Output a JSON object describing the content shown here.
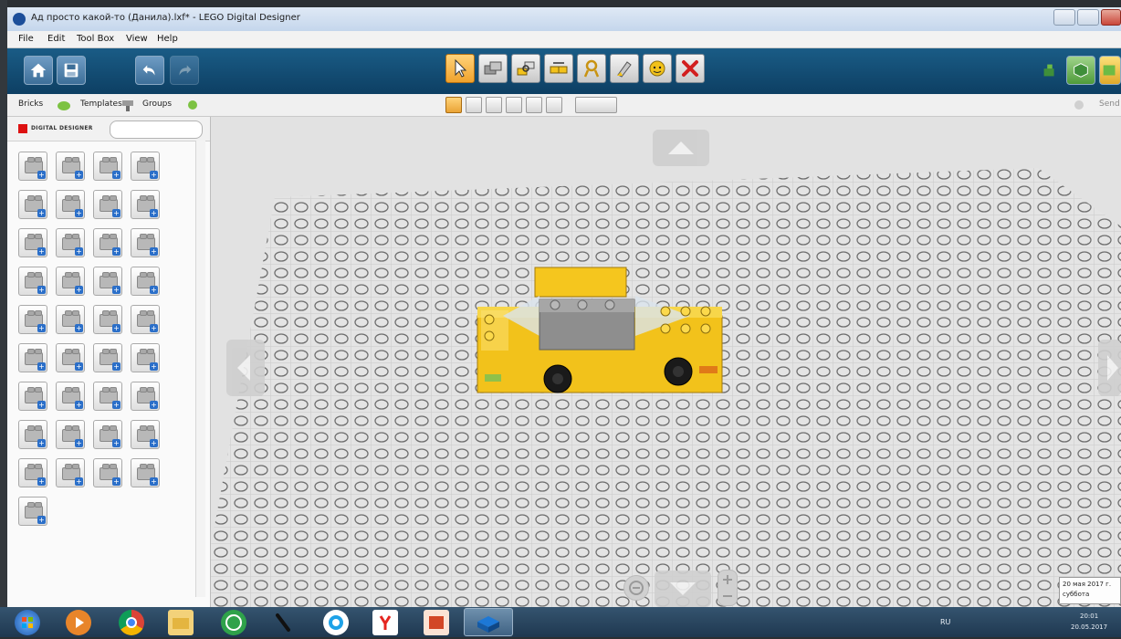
{
  "window": {
    "title": "Ад просто какой-то (Данила).lxf* - LEGO Digital Designer"
  },
  "menu": {
    "items": [
      "File",
      "Edit",
      "Tool Box",
      "View",
      "Help"
    ]
  },
  "toolbar": {
    "left_buttons": [
      "home-icon",
      "save-icon",
      "undo-icon",
      "redo-icon"
    ],
    "tools": [
      "select-tool-icon",
      "clone-tool-icon",
      "hinge-tool-icon",
      "hinge-align-tool-icon",
      "flex-tool-icon",
      "paint-tool-icon",
      "hide-tool-icon",
      "delete-tool-icon"
    ],
    "active_tool": "select-tool-icon",
    "right_buttons": [
      "build-mode-icon",
      "view-mode-icon",
      "building-guide-icon"
    ]
  },
  "subbar": {
    "tabs": [
      "Bricks",
      "Templates",
      "Groups"
    ],
    "right_label": "Send"
  },
  "palette": {
    "brand": "DIGITAL DESIGNER",
    "search_placeholder": "",
    "tile_count": 37
  },
  "status": {
    "date": "20 мая 2017 г.",
    "weekday": "суббота",
    "time": "20:01",
    "short_date": "20.05.2017",
    "lang": "RU"
  },
  "colors": {
    "toolbar": "#0d3f63",
    "active_tool": "#f0a22c",
    "car_yellow": "#f2c21b",
    "baseplate": "#e4e4e4"
  }
}
